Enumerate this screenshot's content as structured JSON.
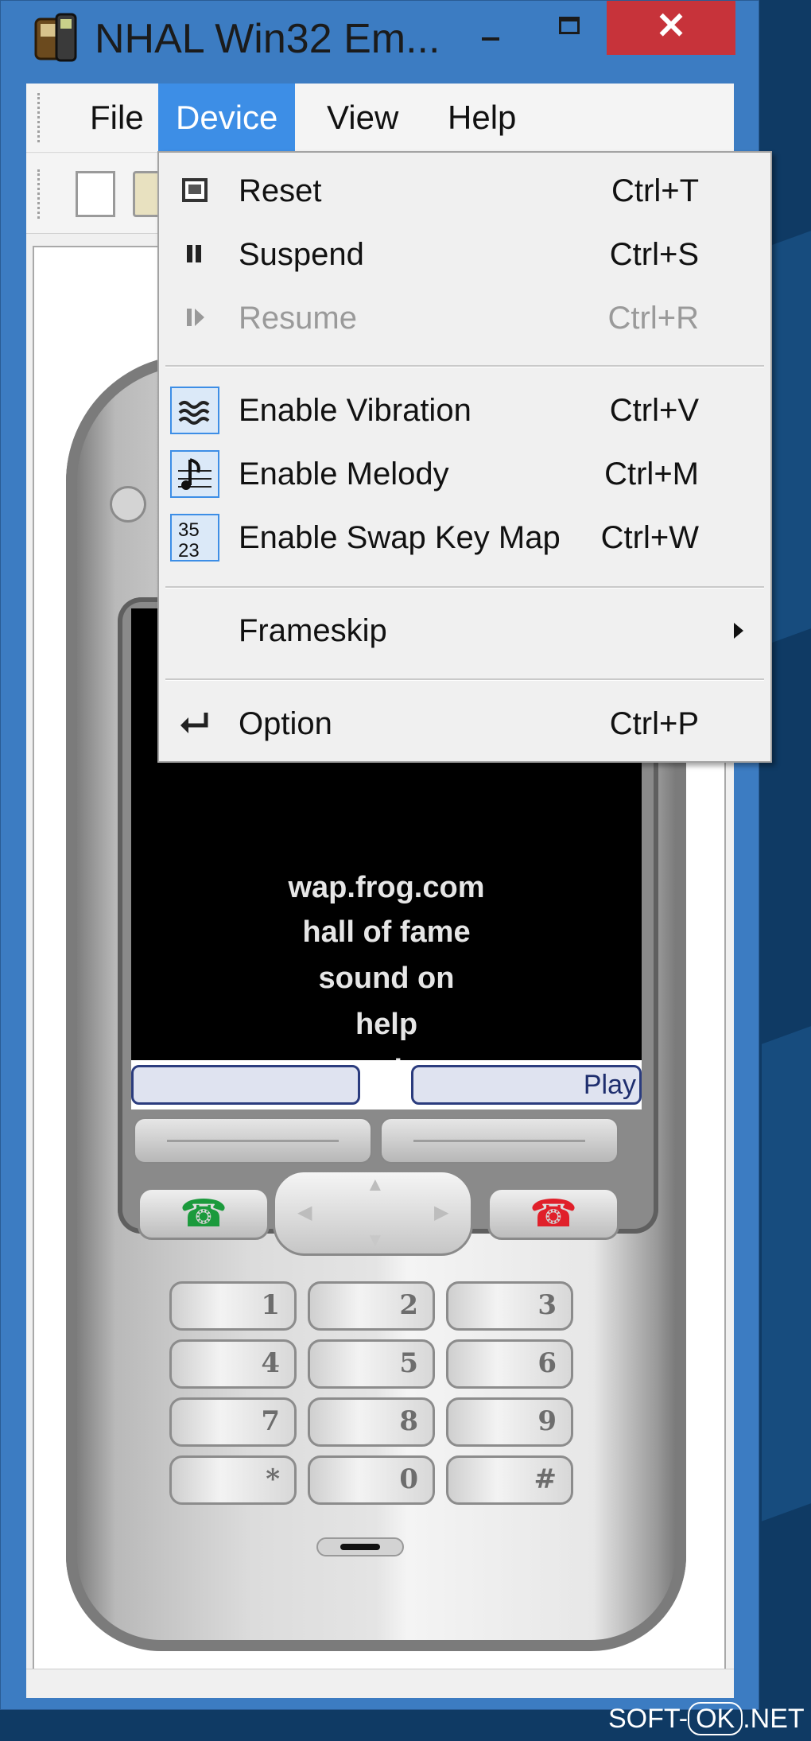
{
  "window": {
    "title": "NHAL Win32 Em...",
    "close_label": "✕"
  },
  "menubar": {
    "items": [
      "File",
      "Device",
      "View",
      "Help"
    ],
    "active": "Device"
  },
  "device_menu": {
    "items": [
      {
        "label": "Reset",
        "shortcut": "Ctrl+T",
        "icon": "reset-icon",
        "enabled": true
      },
      {
        "label": "Suspend",
        "shortcut": "Ctrl+S",
        "icon": "suspend-icon",
        "enabled": true
      },
      {
        "label": "Resume",
        "shortcut": "Ctrl+R",
        "icon": "resume-icon",
        "enabled": false
      },
      {
        "label": "Enable Vibration",
        "shortcut": "Ctrl+V",
        "icon": "vibration-icon",
        "enabled": true
      },
      {
        "label": "Enable Melody",
        "shortcut": "Ctrl+M",
        "icon": "melody-icon",
        "enabled": true
      },
      {
        "label": "Enable Swap Key Map",
        "shortcut": "Ctrl+W",
        "icon": "swap-key-map-icon",
        "enabled": true
      },
      {
        "label": "Frameskip",
        "shortcut": "",
        "icon": "",
        "enabled": true,
        "submenu": true
      },
      {
        "label": "Option",
        "shortcut": "Ctrl+P",
        "icon": "enter-arrow-icon",
        "enabled": true
      }
    ]
  },
  "phone": {
    "screen_lines": [
      "wap.frog.com",
      "hall of fame",
      "sound on",
      "help",
      "exit"
    ],
    "softkey_right": "Play",
    "softkey_left": "",
    "keys": [
      "1",
      "2",
      "3",
      "4",
      "5",
      "6",
      "7",
      "8",
      "9",
      "*",
      "0",
      "#"
    ],
    "call_icon": "☎",
    "end_icon": "☎"
  },
  "watermark": {
    "prefix": "SOFT-",
    "mid": "OK",
    "suffix": ".NET"
  },
  "colors": {
    "menu_highlight": "#3d8ee6",
    "window_frame": "#3c7cc2",
    "close_button": "#c7333a"
  }
}
